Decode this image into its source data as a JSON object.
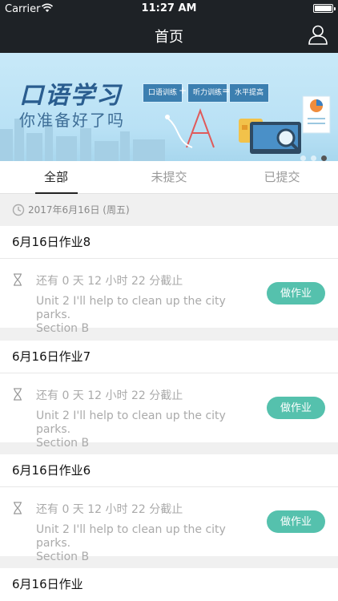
{
  "status": {
    "carrier": "Carrier",
    "time": "11:27 AM"
  },
  "nav": {
    "title": "首页",
    "profile_icon": "user-icon"
  },
  "banner": {
    "title": "口语学习",
    "subtitle": "你准备好了吗",
    "skills": [
      "口语训练",
      "听力训练",
      "水平提高"
    ],
    "ops": [
      "+",
      "="
    ],
    "slides": 3,
    "active_slide": 2
  },
  "tabs": [
    {
      "label": "全部",
      "active": true
    },
    {
      "label": "未提交",
      "active": false
    },
    {
      "label": "已提交",
      "active": false
    }
  ],
  "date_header": "2017年6月16日 (周五)",
  "assignments": [
    {
      "title": "6月16日作业8",
      "deadline": "还有 0 天 12 小时 22 分截止",
      "unit": "Unit 2 I'll help to clean up the city parks.",
      "section": "Section B",
      "action": "做作业"
    },
    {
      "title": "6月16日作业7",
      "deadline": "还有 0 天 12 小时 22 分截止",
      "unit": "Unit 2 I'll help to clean up the city parks.",
      "section": "Section B",
      "action": "做作业"
    },
    {
      "title": "6月16日作业6",
      "deadline": "还有 0 天 12 小时 22 分截止",
      "unit": "Unit 2 I'll help to clean up the city parks.",
      "section": "Section B",
      "action": "做作业"
    },
    {
      "title": "6月16日作业"
    }
  ],
  "colors": {
    "header": "#1e2226",
    "accent": "#55c1ad",
    "banner": "#b9e1f5"
  }
}
